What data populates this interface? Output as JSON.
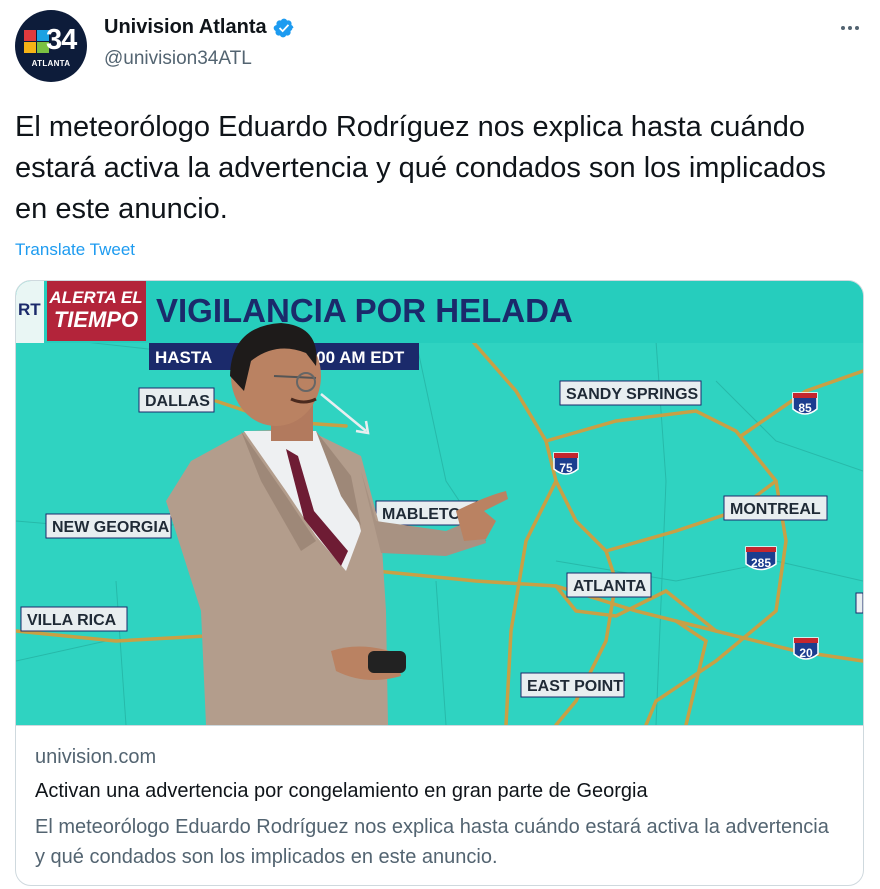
{
  "user": {
    "display_name": "Univision Atlanta",
    "handle": "@univision34ATL",
    "avatar_number": "34",
    "avatar_city": "ATLANTA"
  },
  "tweet": {
    "text": "El meteorólogo Eduardo Rodríguez nos explica hasta cuándo estará activa la advertencia y qué condados son los implicados en este anuncio.",
    "translate_label": "Translate Tweet"
  },
  "media": {
    "alert_line1": "ALERTA EL",
    "alert_line2": "TIEMPO",
    "cut_label": "RT",
    "headline": "VIGILANCIA POR HELADA",
    "until_prefix": "HASTA",
    "until_time": "0:00 AM EDT",
    "map_labels": {
      "dallas": "DALLAS",
      "sandy_springs": "SANDY SPRINGS",
      "new_georgia": "NEW GEORGIA",
      "mableton": "MABLETON",
      "montreal": "MONTREAL",
      "atlanta": "ATLANTA",
      "villa_rica": "VILLA RICA",
      "east_point": "EAST POINT"
    },
    "highway_shields": {
      "i85": "85",
      "i75": "75",
      "i285": "285",
      "i20": "20"
    }
  },
  "card": {
    "domain": "univision.com",
    "title": "Activan una advertencia por congelamiento en gran parte de Georgia",
    "description": "El meteorólogo Eduardo Rodríguez nos explica hasta cuándo estará activa la advertencia y qué condados son los implicados en este anuncio."
  },
  "colors": {
    "link": "#1d9bf0",
    "map_teal": "#2fd3c1",
    "banner_teal": "#26cdbd",
    "alert_red": "#b3243a",
    "navy": "#1b2a6b",
    "road": "#c8a045"
  }
}
